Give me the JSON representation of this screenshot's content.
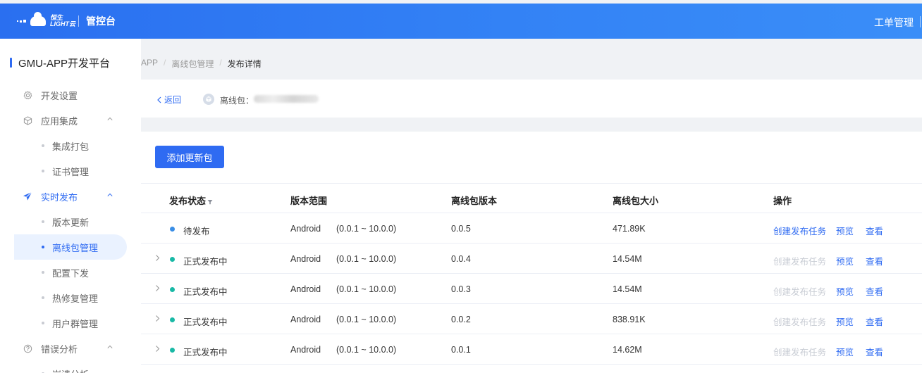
{
  "topbar": {
    "logo_line1": "恒生",
    "logo_line2": "LIGHT云",
    "console_label": "管控台",
    "work_order_label": "工单管理"
  },
  "sidebar": {
    "app_title": "GMU-APP开发平台",
    "items": [
      {
        "label": "开发设置",
        "icon": "gear-icon"
      },
      {
        "label": "应用集成",
        "icon": "cube-icon"
      },
      {
        "label": "集成打包"
      },
      {
        "label": "证书管理"
      },
      {
        "label": "实时发布",
        "icon": "send-icon"
      },
      {
        "label": "版本更新"
      },
      {
        "label": "离线包管理"
      },
      {
        "label": "配置下发"
      },
      {
        "label": "热修复管理"
      },
      {
        "label": "用户群管理"
      },
      {
        "label": "错误分析",
        "icon": "question-icon"
      },
      {
        "label": "崩溃分析"
      }
    ]
  },
  "breadcrumb": {
    "items": [
      "APP",
      "离线包管理",
      "发布详情"
    ],
    "separator": "/"
  },
  "info": {
    "back_label": "返回",
    "package_label": "离线包："
  },
  "toolbar": {
    "add_label": "添加更新包"
  },
  "table": {
    "headers": [
      "发布状态",
      "版本范围",
      "离线包版本",
      "离线包大小",
      "操作"
    ],
    "rows": [
      {
        "status": "待发布",
        "status_color": "#3a8ee6",
        "expandable": false,
        "os": "Android",
        "range": "(0.0.1 ~ 10.0.0)",
        "version": "0.0.5",
        "size": "471.89K",
        "create_enabled": true
      },
      {
        "status": "正式发布中",
        "status_color": "#19b9a6",
        "expandable": true,
        "os": "Android",
        "range": "(0.0.1 ~ 10.0.0)",
        "version": "0.0.4",
        "size": "14.54M",
        "create_enabled": false
      },
      {
        "status": "正式发布中",
        "status_color": "#19b9a6",
        "expandable": true,
        "os": "Android",
        "range": "(0.0.1 ~ 10.0.0)",
        "version": "0.0.3",
        "size": "14.54M",
        "create_enabled": false
      },
      {
        "status": "正式发布中",
        "status_color": "#19b9a6",
        "expandable": true,
        "os": "Android",
        "range": "(0.0.1 ~ 10.0.0)",
        "version": "0.0.2",
        "size": "838.91K",
        "create_enabled": false
      },
      {
        "status": "正式发布中",
        "status_color": "#19b9a6",
        "expandable": true,
        "os": "Android",
        "range": "(0.0.1 ~ 10.0.0)",
        "version": "0.0.1",
        "size": "14.62M",
        "create_enabled": false
      }
    ],
    "actions": {
      "create_label": "创建发布任务",
      "preview_label": "预览",
      "view_label": "查看"
    }
  },
  "colors": {
    "primary": "#2f6bf2",
    "topbar": "#2f77f2",
    "pending": "#3a8ee6",
    "live": "#19b9a6",
    "disabled": "#c8ccd4"
  }
}
